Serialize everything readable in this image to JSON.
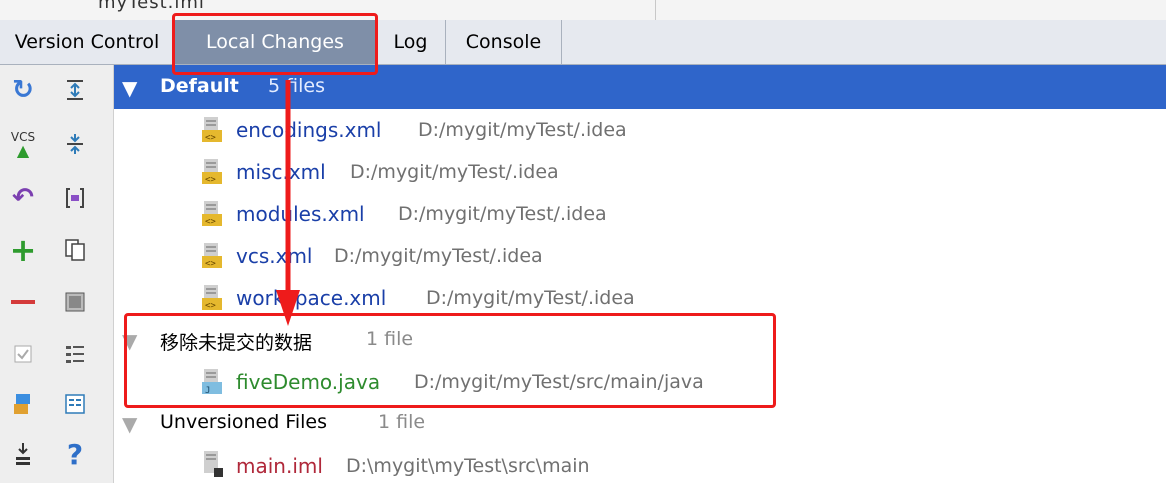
{
  "top_fragment": "myTest.iml",
  "tabs": [
    {
      "label": "Version Control",
      "active": false
    },
    {
      "label": "Local Changes",
      "active": true
    },
    {
      "label": "Log",
      "active": false
    },
    {
      "label": "Console",
      "active": false
    }
  ],
  "toolbar": {
    "left": [
      "refresh-icon",
      "vcs-commit-icon",
      "rollback-icon",
      "add-icon",
      "remove-icon",
      "checkbox-icon",
      "shelve-icon",
      "sort-icon"
    ],
    "right": [
      "expand-all-icon",
      "collapse-all-icon",
      "group-icon",
      "copy-icon",
      "preview-icon",
      "list-icon",
      "diff-icon",
      "help-icon"
    ],
    "vcs_label": "VCS",
    "help_label": "?"
  },
  "groups": {
    "default": {
      "name": "Default",
      "count": "5 files"
    },
    "new_list": {
      "name": "移除未提交的数据",
      "count": "1 file"
    },
    "unversioned": {
      "name": "Unversioned Files",
      "count": "1 file"
    }
  },
  "default_files": [
    {
      "name": "encodings.xml",
      "path": "D:/mygit/myTest/.idea"
    },
    {
      "name": "misc.xml",
      "path": "D:/mygit/myTest/.idea"
    },
    {
      "name": "modules.xml",
      "path": "D:/mygit/myTest/.idea"
    },
    {
      "name": "vcs.xml",
      "path": "D:/mygit/myTest/.idea"
    },
    {
      "name": "workspace.xml",
      "path": "D:/mygit/myTest/.idea"
    }
  ],
  "new_list_files": [
    {
      "name": "fiveDemo.java",
      "path": "D:/mygit/myTest/src/main/java"
    }
  ],
  "unversioned_files": [
    {
      "name": "main.iml",
      "path": "D:\\mygit\\myTest\\src\\main"
    }
  ],
  "colors": {
    "selected_row": "#2f65ca",
    "active_tab": "#7f8fa8",
    "file_link": "#1a3fa8",
    "added_file": "#2e8b2e",
    "annotation_red": "#ee1b1b"
  }
}
